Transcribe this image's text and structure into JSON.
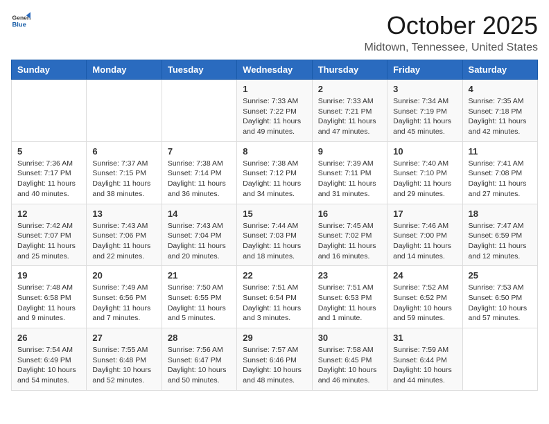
{
  "header": {
    "logo": {
      "text_general": "General",
      "text_blue": "Blue"
    },
    "title": "October 2025",
    "location": "Midtown, Tennessee, United States"
  },
  "weekdays": [
    "Sunday",
    "Monday",
    "Tuesday",
    "Wednesday",
    "Thursday",
    "Friday",
    "Saturday"
  ],
  "weeks": [
    [
      {
        "day": null
      },
      {
        "day": null
      },
      {
        "day": null
      },
      {
        "day": "1",
        "sunrise": "Sunrise: 7:33 AM",
        "sunset": "Sunset: 7:22 PM",
        "daylight": "Daylight: 11 hours and 49 minutes."
      },
      {
        "day": "2",
        "sunrise": "Sunrise: 7:33 AM",
        "sunset": "Sunset: 7:21 PM",
        "daylight": "Daylight: 11 hours and 47 minutes."
      },
      {
        "day": "3",
        "sunrise": "Sunrise: 7:34 AM",
        "sunset": "Sunset: 7:19 PM",
        "daylight": "Daylight: 11 hours and 45 minutes."
      },
      {
        "day": "4",
        "sunrise": "Sunrise: 7:35 AM",
        "sunset": "Sunset: 7:18 PM",
        "daylight": "Daylight: 11 hours and 42 minutes."
      }
    ],
    [
      {
        "day": "5",
        "sunrise": "Sunrise: 7:36 AM",
        "sunset": "Sunset: 7:17 PM",
        "daylight": "Daylight: 11 hours and 40 minutes."
      },
      {
        "day": "6",
        "sunrise": "Sunrise: 7:37 AM",
        "sunset": "Sunset: 7:15 PM",
        "daylight": "Daylight: 11 hours and 38 minutes."
      },
      {
        "day": "7",
        "sunrise": "Sunrise: 7:38 AM",
        "sunset": "Sunset: 7:14 PM",
        "daylight": "Daylight: 11 hours and 36 minutes."
      },
      {
        "day": "8",
        "sunrise": "Sunrise: 7:38 AM",
        "sunset": "Sunset: 7:12 PM",
        "daylight": "Daylight: 11 hours and 34 minutes."
      },
      {
        "day": "9",
        "sunrise": "Sunrise: 7:39 AM",
        "sunset": "Sunset: 7:11 PM",
        "daylight": "Daylight: 11 hours and 31 minutes."
      },
      {
        "day": "10",
        "sunrise": "Sunrise: 7:40 AM",
        "sunset": "Sunset: 7:10 PM",
        "daylight": "Daylight: 11 hours and 29 minutes."
      },
      {
        "day": "11",
        "sunrise": "Sunrise: 7:41 AM",
        "sunset": "Sunset: 7:08 PM",
        "daylight": "Daylight: 11 hours and 27 minutes."
      }
    ],
    [
      {
        "day": "12",
        "sunrise": "Sunrise: 7:42 AM",
        "sunset": "Sunset: 7:07 PM",
        "daylight": "Daylight: 11 hours and 25 minutes."
      },
      {
        "day": "13",
        "sunrise": "Sunrise: 7:43 AM",
        "sunset": "Sunset: 7:06 PM",
        "daylight": "Daylight: 11 hours and 22 minutes."
      },
      {
        "day": "14",
        "sunrise": "Sunrise: 7:43 AM",
        "sunset": "Sunset: 7:04 PM",
        "daylight": "Daylight: 11 hours and 20 minutes."
      },
      {
        "day": "15",
        "sunrise": "Sunrise: 7:44 AM",
        "sunset": "Sunset: 7:03 PM",
        "daylight": "Daylight: 11 hours and 18 minutes."
      },
      {
        "day": "16",
        "sunrise": "Sunrise: 7:45 AM",
        "sunset": "Sunset: 7:02 PM",
        "daylight": "Daylight: 11 hours and 16 minutes."
      },
      {
        "day": "17",
        "sunrise": "Sunrise: 7:46 AM",
        "sunset": "Sunset: 7:00 PM",
        "daylight": "Daylight: 11 hours and 14 minutes."
      },
      {
        "day": "18",
        "sunrise": "Sunrise: 7:47 AM",
        "sunset": "Sunset: 6:59 PM",
        "daylight": "Daylight: 11 hours and 12 minutes."
      }
    ],
    [
      {
        "day": "19",
        "sunrise": "Sunrise: 7:48 AM",
        "sunset": "Sunset: 6:58 PM",
        "daylight": "Daylight: 11 hours and 9 minutes."
      },
      {
        "day": "20",
        "sunrise": "Sunrise: 7:49 AM",
        "sunset": "Sunset: 6:56 PM",
        "daylight": "Daylight: 11 hours and 7 minutes."
      },
      {
        "day": "21",
        "sunrise": "Sunrise: 7:50 AM",
        "sunset": "Sunset: 6:55 PM",
        "daylight": "Daylight: 11 hours and 5 minutes."
      },
      {
        "day": "22",
        "sunrise": "Sunrise: 7:51 AM",
        "sunset": "Sunset: 6:54 PM",
        "daylight": "Daylight: 11 hours and 3 minutes."
      },
      {
        "day": "23",
        "sunrise": "Sunrise: 7:51 AM",
        "sunset": "Sunset: 6:53 PM",
        "daylight": "Daylight: 11 hours and 1 minute."
      },
      {
        "day": "24",
        "sunrise": "Sunrise: 7:52 AM",
        "sunset": "Sunset: 6:52 PM",
        "daylight": "Daylight: 10 hours and 59 minutes."
      },
      {
        "day": "25",
        "sunrise": "Sunrise: 7:53 AM",
        "sunset": "Sunset: 6:50 PM",
        "daylight": "Daylight: 10 hours and 57 minutes."
      }
    ],
    [
      {
        "day": "26",
        "sunrise": "Sunrise: 7:54 AM",
        "sunset": "Sunset: 6:49 PM",
        "daylight": "Daylight: 10 hours and 54 minutes."
      },
      {
        "day": "27",
        "sunrise": "Sunrise: 7:55 AM",
        "sunset": "Sunset: 6:48 PM",
        "daylight": "Daylight: 10 hours and 52 minutes."
      },
      {
        "day": "28",
        "sunrise": "Sunrise: 7:56 AM",
        "sunset": "Sunset: 6:47 PM",
        "daylight": "Daylight: 10 hours and 50 minutes."
      },
      {
        "day": "29",
        "sunrise": "Sunrise: 7:57 AM",
        "sunset": "Sunset: 6:46 PM",
        "daylight": "Daylight: 10 hours and 48 minutes."
      },
      {
        "day": "30",
        "sunrise": "Sunrise: 7:58 AM",
        "sunset": "Sunset: 6:45 PM",
        "daylight": "Daylight: 10 hours and 46 minutes."
      },
      {
        "day": "31",
        "sunrise": "Sunrise: 7:59 AM",
        "sunset": "Sunset: 6:44 PM",
        "daylight": "Daylight: 10 hours and 44 minutes."
      },
      {
        "day": null
      }
    ]
  ]
}
